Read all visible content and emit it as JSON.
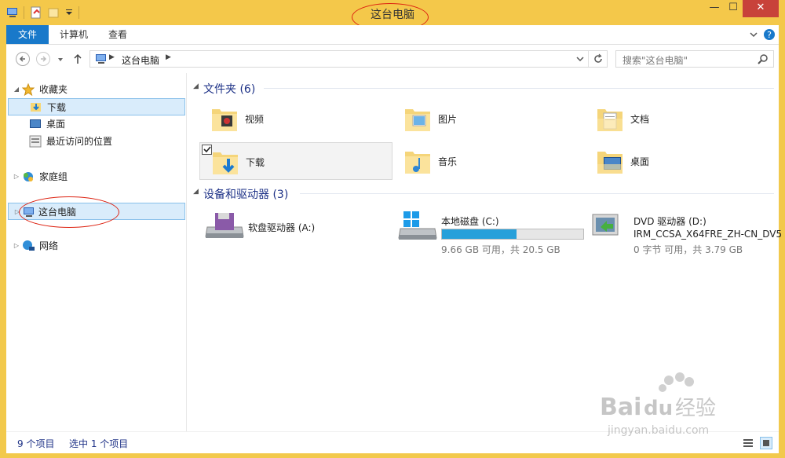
{
  "window": {
    "title": "这台电脑",
    "controls": {
      "minimize": "—",
      "maximize": "☐",
      "close": "✕"
    }
  },
  "ribbon": {
    "tabs": [
      {
        "label": "文件",
        "active": true
      },
      {
        "label": "计算机"
      },
      {
        "label": "查看"
      }
    ]
  },
  "address": {
    "path": "这台电脑",
    "search_placeholder": "搜索\"这台电脑\""
  },
  "nav": {
    "favorites": {
      "label": "收藏夹",
      "items": [
        {
          "label": "下载",
          "selected": true
        },
        {
          "label": "桌面"
        },
        {
          "label": "最近访问的位置"
        }
      ]
    },
    "homegroup": "家庭组",
    "this_pc": "这台电脑",
    "network": "网络"
  },
  "folders": {
    "header": "文件夹 (6)",
    "items": [
      {
        "label": "视频"
      },
      {
        "label": "图片"
      },
      {
        "label": "文档"
      },
      {
        "label": "下载",
        "selected": true
      },
      {
        "label": "音乐"
      },
      {
        "label": "桌面"
      }
    ]
  },
  "devices": {
    "header": "设备和驱动器 (3)",
    "items": [
      {
        "label": "软盘驱动器 (A:)"
      },
      {
        "label": "本地磁盘 (C:)",
        "usage_text": "9.66 GB 可用，共 20.5 GB",
        "used_fraction": 0.53
      },
      {
        "label": "DVD 驱动器 (D:)",
        "volume": "IRM_CCSA_X64FRE_ZH-CN_DV5",
        "usage_text": "0 字节 可用，共 3.79 GB"
      }
    ]
  },
  "status": {
    "count": "9 个项目",
    "selected": "选中 1 个项目"
  },
  "watermark": {
    "brand": "Baidu经验",
    "url": "jingyan.baidu.com"
  },
  "colors": {
    "frame": "#f2c94c",
    "accent": "#1979ca",
    "group_header": "#1e3287",
    "selection_bg": "#d9ecfb",
    "usage_bar": "#26a0da"
  }
}
